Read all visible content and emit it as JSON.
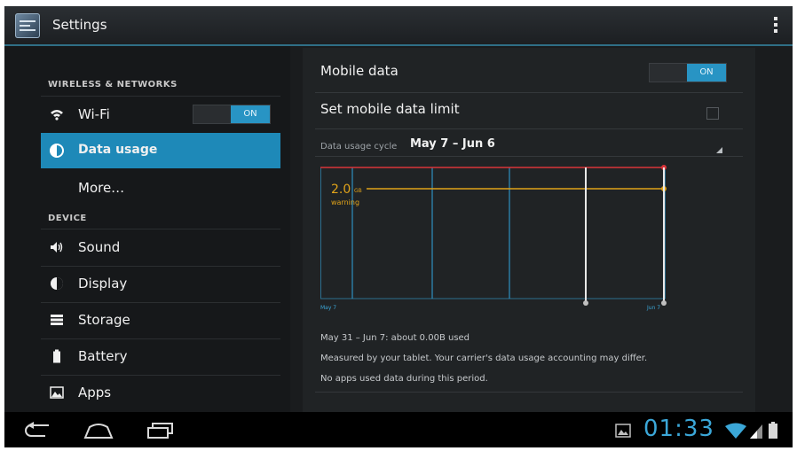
{
  "app": {
    "title": "Settings",
    "icon": "settings-app-icon",
    "overflow_icon": "overflow-menu-icon"
  },
  "sidebar": {
    "sections": [
      {
        "label": "WIRELESS & NETWORKS"
      },
      {
        "label": "DEVICE"
      }
    ],
    "items": [
      {
        "label": "Wi-Fi",
        "icon": "wifi-icon",
        "toggle": "ON"
      },
      {
        "label": "Data usage",
        "icon": "data-usage-icon",
        "selected": true
      },
      {
        "label": "More…"
      },
      {
        "label": "Sound",
        "icon": "sound-icon"
      },
      {
        "label": "Display",
        "icon": "display-icon"
      },
      {
        "label": "Storage",
        "icon": "storage-icon"
      },
      {
        "label": "Battery",
        "icon": "battery-icon"
      },
      {
        "label": "Apps",
        "icon": "apps-icon"
      }
    ]
  },
  "main": {
    "mobile_data": {
      "label": "Mobile data",
      "toggle": "ON"
    },
    "data_limit": {
      "label": "Set mobile data limit",
      "checked": false
    },
    "cycle": {
      "label": "Data usage cycle",
      "value": "May 7 – Jun 6"
    },
    "usage_line": "May 31 – Jun 7: about 0.00B used",
    "note1": "Measured by your tablet. Your carrier's data usage accounting may differ.",
    "note2": "No apps used data during this period."
  },
  "chart_data": {
    "type": "line",
    "x_start_label": "May 7",
    "x_end_label": "Jun 7",
    "warning_value": "2.0",
    "warning_unit": "GB",
    "warning_label": "warning"
  },
  "status": {
    "time": "01:33"
  },
  "colors": {
    "accent": "#1e89b8",
    "toggle_on": "#2894c4",
    "limit": "#d9343a",
    "warning": "#e0a31a"
  }
}
